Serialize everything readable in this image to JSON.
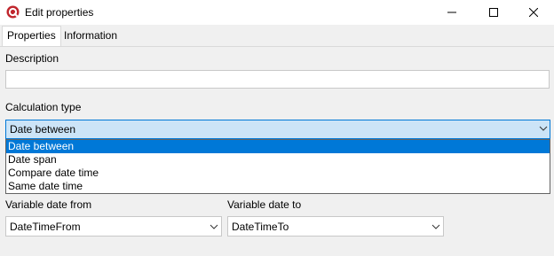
{
  "window": {
    "title": "Edit properties",
    "app_icon": "app-logo-icon",
    "controls": [
      "minimize-icon",
      "maximize-icon",
      "close-icon"
    ]
  },
  "tabs": [
    {
      "label": "Properties",
      "active": true
    },
    {
      "label": "Information",
      "active": false
    }
  ],
  "description": {
    "label": "Description",
    "value": ""
  },
  "calculation_type": {
    "label": "Calculation type",
    "selected": "Date between",
    "options": [
      "Date between",
      "Date span",
      "Compare date time",
      "Same date time"
    ]
  },
  "variable_date_from": {
    "label": "Variable date from",
    "value": "DateTimeFrom"
  },
  "variable_date_to": {
    "label": "Variable date to",
    "value": "DateTimeTo"
  },
  "colors": {
    "accent": "#0078d7",
    "selected_field_bg": "#cce4f7",
    "app_icon": "#c0262d"
  }
}
